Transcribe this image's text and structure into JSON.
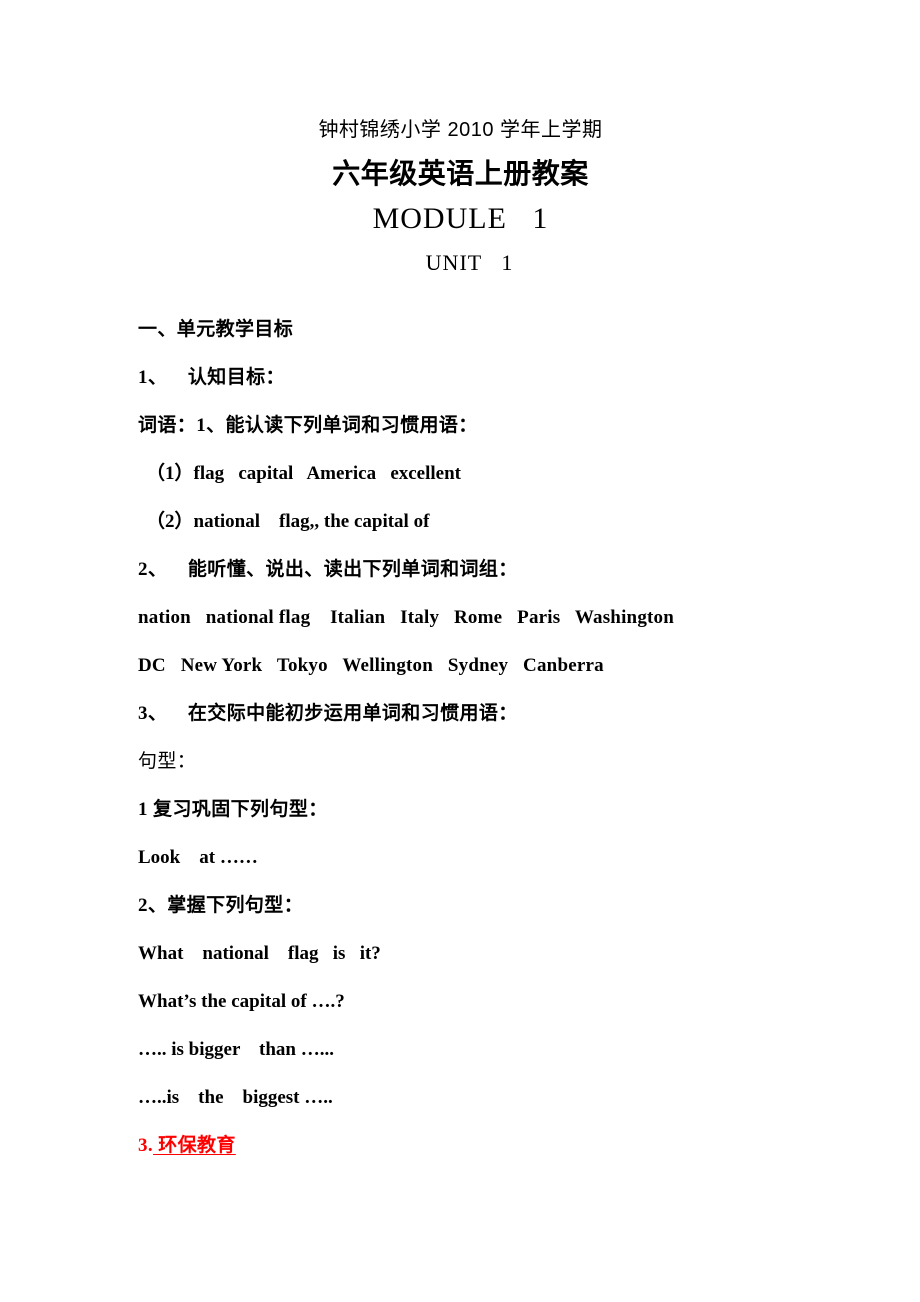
{
  "document": {
    "background_color": "#ffffff",
    "text_color": "#000000",
    "accent_color": "#ff0000"
  },
  "title": {
    "school_line": "钟村锦绣小学 2010 学年上学期",
    "main_line": "六年级英语上册教案",
    "module_line": "MODULE   1",
    "unit_line": "UNIT   1"
  },
  "body": {
    "lines": [
      {
        "text": "一、单元教学目标",
        "style": "cjk"
      },
      {
        "text": "1、    认知目标：",
        "style": "cjk"
      },
      {
        "text": "词语：1、能认读下列单词和习惯用语：",
        "style": "cjk"
      },
      {
        "text": "（1）flag   capital   America   excellent",
        "style": "indent"
      },
      {
        "text": "（2）national    flag,, the capital of",
        "style": "indent"
      },
      {
        "text": "2、    能听懂、说出、读出下列单词和词组：",
        "style": "cjk"
      },
      {
        "text": "nation   national flag    Italian   Italy   Rome   Paris   Washington",
        "style": "wide"
      },
      {
        "text": "DC   New York   Tokyo   Wellington   Sydney   Canberra",
        "style": "wide"
      },
      {
        "text": "3、    在交际中能初步运用单词和习惯用语：",
        "style": "cjk"
      },
      {
        "text": "句型：",
        "style": "hei"
      },
      {
        "text": "1 复习巩固下列句型：",
        "style": "cjk"
      },
      {
        "text": "Look    at ……",
        "style": "plain"
      },
      {
        "text": "2、掌握下列句型：",
        "style": "cjk"
      },
      {
        "text": "What    national    flag   is   it?",
        "style": "plain"
      },
      {
        "text": "What’s the capital of ….?",
        "style": "plain"
      },
      {
        "text": "….. is bigger    than …...",
        "style": "plain"
      },
      {
        "text": "…..is    the    biggest …..",
        "style": "plain"
      }
    ],
    "red_item": {
      "number": "3.",
      "underlined_text": " 环保教育"
    }
  }
}
